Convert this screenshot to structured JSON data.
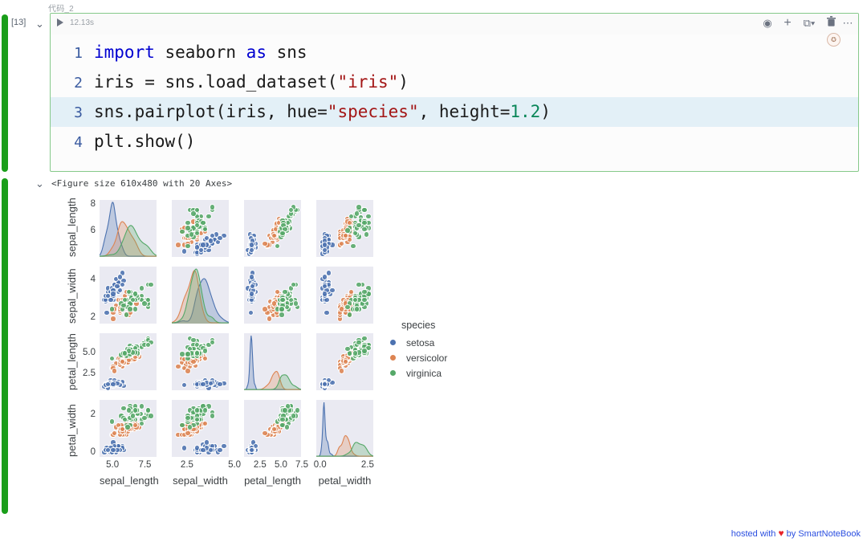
{
  "cell": {
    "title": "代码_2",
    "exec_count": "[13]",
    "exec_time": "12.13s",
    "chevron": "⌄",
    "toolbar": {
      "eye": "◉",
      "plus": "+",
      "copy": "⧉▾",
      "trash": "Ὕ1",
      "more": "⋯",
      "avatar": "✪"
    },
    "code_lines": [
      {
        "no": "1",
        "highlighted": false,
        "tokens": [
          {
            "t": "import ",
            "c": "kw"
          },
          {
            "t": "seaborn ",
            "c": "plain"
          },
          {
            "t": "as ",
            "c": "kw"
          },
          {
            "t": "sns",
            "c": "plain"
          }
        ]
      },
      {
        "no": "2",
        "highlighted": false,
        "tokens": [
          {
            "t": "iris = sns.load_dataset(",
            "c": "plain"
          },
          {
            "t": "\"iris\"",
            "c": "str"
          },
          {
            "t": ")",
            "c": "plain"
          }
        ]
      },
      {
        "no": "3",
        "highlighted": true,
        "tokens": [
          {
            "t": "sns.pairplot(iris, hue=",
            "c": "plain"
          },
          {
            "t": "\"species\"",
            "c": "str"
          },
          {
            "t": ", height=",
            "c": "plain"
          },
          {
            "t": "1.2",
            "c": "num"
          },
          {
            "t": ")",
            "c": "plain"
          }
        ]
      },
      {
        "no": "4",
        "highlighted": false,
        "tokens": [
          {
            "t": "plt.show()",
            "c": "plain"
          }
        ]
      }
    ]
  },
  "output": {
    "chevron": "⌄",
    "repr_text": "<Figure size 610x480 with 20 Axes>"
  },
  "footer": {
    "prefix": "hosted with",
    "heart": "♥",
    "suffix": "by SmartNoteBook"
  },
  "chart_data": {
    "type": "scatter",
    "title": "",
    "variables": [
      "sepal_length",
      "sepal_width",
      "petal_length",
      "petal_width"
    ],
    "hue": "species",
    "legend": {
      "title": "species",
      "position": "right",
      "entries": [
        {
          "label": "setosa",
          "color": "#4c72b0"
        },
        {
          "label": "versicolor",
          "color": "#dd8452"
        },
        {
          "label": "virginica",
          "color": "#55a868"
        }
      ]
    },
    "panel_bg": "#eaeaf2",
    "axis_ranges": {
      "sepal_length": [
        4.0,
        8.4
      ],
      "sepal_width": [
        1.7,
        4.7
      ],
      "petal_length": [
        0.6,
        7.4
      ],
      "petal_width": [
        -0.2,
        2.8
      ]
    },
    "xticks": {
      "sepal_length": [
        5.0,
        7.5
      ],
      "sepal_width": [
        2.5,
        5.0
      ],
      "petal_length": [
        2.5,
        5.0,
        7.5
      ],
      "petal_width": [
        0.0,
        2.5
      ]
    },
    "yticks": {
      "sepal_length": [
        8,
        6
      ],
      "sepal_width": [
        4,
        2
      ],
      "petal_length": [
        5.0,
        2.5
      ],
      "petal_width": [
        2,
        0
      ]
    },
    "xtick_labels": {
      "sepal_length": [
        "5.0",
        "7.5"
      ],
      "sepal_width": [
        "2.5",
        "5.0"
      ],
      "petal_length": [
        "2.5",
        "5.0",
        "7.5"
      ],
      "petal_width": [
        "0.0",
        "2.5"
      ]
    },
    "ytick_labels": {
      "sepal_length": [
        "8",
        "6"
      ],
      "sepal_width": [
        "4",
        "2"
      ],
      "petal_length": [
        "5.0",
        "2.5"
      ],
      "petal_width": [
        "2",
        "0"
      ]
    },
    "diagonal": "kde",
    "n_points": 150,
    "species_order": [
      "setosa",
      "versicolor",
      "virginica"
    ],
    "data": {
      "sepal_length": [
        5.1,
        4.9,
        4.7,
        4.6,
        5.0,
        5.4,
        4.6,
        5.0,
        4.4,
        4.9,
        5.4,
        4.8,
        4.8,
        4.3,
        5.8,
        5.7,
        5.4,
        5.1,
        5.7,
        5.1,
        5.4,
        5.1,
        4.6,
        5.1,
        4.8,
        5.0,
        5.0,
        5.2,
        5.2,
        4.7,
        4.8,
        5.4,
        5.2,
        5.5,
        4.9,
        5.0,
        5.5,
        4.9,
        4.4,
        5.1,
        5.0,
        4.5,
        4.4,
        5.0,
        5.1,
        4.8,
        5.1,
        4.6,
        5.3,
        5.0,
        7.0,
        6.4,
        6.9,
        5.5,
        6.5,
        5.7,
        6.3,
        4.9,
        6.6,
        5.2,
        5.0,
        5.9,
        6.0,
        6.1,
        5.6,
        6.7,
        5.6,
        5.8,
        6.2,
        5.6,
        5.9,
        6.1,
        6.3,
        6.1,
        6.4,
        6.6,
        6.8,
        6.7,
        6.0,
        5.7,
        5.5,
        5.5,
        5.8,
        6.0,
        5.4,
        6.0,
        6.7,
        6.3,
        5.6,
        5.5,
        5.5,
        6.1,
        5.8,
        5.0,
        5.6,
        5.7,
        5.7,
        6.2,
        5.1,
        5.7,
        6.3,
        5.8,
        7.1,
        6.3,
        6.5,
        7.6,
        4.9,
        7.3,
        6.7,
        7.2,
        6.5,
        6.4,
        6.8,
        5.7,
        5.8,
        6.4,
        6.5,
        7.7,
        7.7,
        6.0,
        6.9,
        5.6,
        7.7,
        6.3,
        6.7,
        7.2,
        6.2,
        6.1,
        6.4,
        7.2,
        7.4,
        7.9,
        6.4,
        6.3,
        6.1,
        7.7,
        6.3,
        6.4,
        6.0,
        6.9,
        6.7,
        6.9,
        5.8,
        6.8,
        6.7,
        6.7,
        6.3,
        6.5,
        6.2,
        5.9
      ],
      "sepal_width": [
        3.5,
        3.0,
        3.2,
        3.1,
        3.6,
        3.9,
        3.4,
        3.4,
        2.9,
        3.1,
        3.7,
        3.4,
        3.0,
        3.0,
        4.0,
        4.4,
        3.9,
        3.5,
        3.8,
        3.8,
        3.4,
        3.7,
        3.6,
        3.3,
        3.4,
        3.0,
        3.4,
        3.5,
        3.4,
        3.2,
        3.1,
        3.4,
        4.1,
        4.2,
        3.1,
        3.2,
        3.5,
        3.6,
        3.0,
        3.4,
        3.5,
        2.3,
        3.2,
        3.5,
        3.8,
        3.0,
        3.8,
        3.2,
        3.7,
        3.3,
        3.2,
        3.2,
        3.1,
        2.3,
        2.8,
        2.8,
        3.3,
        2.4,
        2.9,
        2.7,
        2.0,
        3.0,
        2.2,
        2.9,
        2.9,
        3.1,
        3.0,
        2.7,
        2.2,
        2.5,
        3.2,
        2.8,
        2.5,
        2.8,
        2.9,
        3.0,
        2.8,
        3.0,
        2.9,
        2.6,
        2.4,
        2.4,
        2.7,
        2.7,
        3.0,
        3.4,
        3.1,
        2.3,
        3.0,
        2.5,
        2.6,
        3.0,
        2.6,
        2.3,
        2.7,
        3.0,
        2.9,
        2.9,
        2.5,
        2.8,
        3.3,
        2.7,
        3.0,
        2.9,
        3.0,
        3.0,
        2.5,
        2.9,
        2.5,
        3.6,
        3.2,
        2.7,
        3.0,
        2.5,
        2.8,
        3.2,
        3.0,
        3.8,
        2.6,
        2.2,
        3.2,
        2.8,
        2.8,
        2.7,
        3.3,
        3.2,
        2.8,
        3.0,
        2.8,
        3.0,
        2.8,
        3.8,
        2.8,
        2.8,
        2.6,
        3.0,
        3.4,
        3.1,
        3.0,
        3.1,
        3.1,
        3.1,
        2.7,
        3.2,
        3.3,
        3.0,
        2.5,
        3.0,
        3.4,
        3.0
      ],
      "petal_length": [
        1.4,
        1.4,
        1.3,
        1.5,
        1.4,
        1.7,
        1.4,
        1.5,
        1.4,
        1.5,
        1.5,
        1.6,
        1.4,
        1.1,
        1.2,
        1.5,
        1.3,
        1.4,
        1.7,
        1.5,
        1.7,
        1.5,
        1.0,
        1.7,
        1.9,
        1.6,
        1.6,
        1.5,
        1.4,
        1.6,
        1.6,
        1.5,
        1.5,
        1.4,
        1.5,
        1.2,
        1.3,
        1.4,
        1.3,
        1.5,
        1.3,
        1.3,
        1.3,
        1.6,
        1.9,
        1.4,
        1.6,
        1.4,
        1.5,
        1.4,
        4.7,
        4.5,
        4.9,
        4.0,
        4.6,
        4.5,
        4.7,
        3.3,
        4.6,
        3.9,
        3.5,
        4.2,
        4.0,
        4.7,
        3.6,
        4.4,
        4.5,
        4.1,
        4.5,
        3.9,
        4.8,
        4.0,
        4.9,
        4.7,
        4.3,
        4.4,
        4.8,
        5.0,
        4.5,
        3.5,
        3.8,
        3.7,
        3.9,
        5.1,
        4.5,
        4.5,
        4.7,
        4.4,
        4.1,
        4.0,
        4.4,
        4.6,
        4.0,
        3.3,
        4.2,
        4.2,
        4.2,
        4.3,
        3.0,
        4.1,
        6.0,
        5.1,
        5.9,
        5.6,
        5.8,
        6.6,
        4.5,
        6.3,
        5.8,
        6.1,
        5.1,
        5.3,
        5.5,
        5.0,
        5.1,
        5.3,
        5.5,
        6.7,
        6.9,
        5.0,
        5.7,
        4.9,
        6.7,
        4.9,
        5.7,
        6.0,
        4.8,
        4.9,
        5.6,
        5.8,
        6.1,
        6.4,
        5.6,
        5.1,
        5.6,
        6.1,
        5.6,
        5.5,
        4.8,
        5.4,
        5.6,
        5.1,
        5.1,
        5.9,
        5.7,
        5.2,
        5.0,
        5.2,
        5.4,
        5.1
      ],
      "petal_width": [
        0.2,
        0.2,
        0.2,
        0.2,
        0.2,
        0.4,
        0.3,
        0.2,
        0.2,
        0.1,
        0.2,
        0.2,
        0.1,
        0.1,
        0.2,
        0.4,
        0.4,
        0.3,
        0.3,
        0.3,
        0.2,
        0.4,
        0.2,
        0.5,
        0.2,
        0.2,
        0.4,
        0.2,
        0.2,
        0.2,
        0.2,
        0.4,
        0.1,
        0.2,
        0.2,
        0.2,
        0.2,
        0.1,
        0.2,
        0.2,
        0.3,
        0.3,
        0.2,
        0.6,
        0.4,
        0.3,
        0.2,
        0.2,
        0.2,
        0.2,
        1.4,
        1.5,
        1.5,
        1.3,
        1.5,
        1.3,
        1.6,
        1.0,
        1.3,
        1.4,
        1.0,
        1.5,
        1.0,
        1.4,
        1.3,
        1.4,
        1.5,
        1.0,
        1.5,
        1.1,
        1.8,
        1.3,
        1.5,
        1.2,
        1.3,
        1.4,
        1.4,
        1.7,
        1.5,
        1.0,
        1.1,
        1.0,
        1.2,
        1.6,
        1.5,
        1.6,
        1.5,
        1.3,
        1.3,
        1.3,
        1.2,
        1.4,
        1.2,
        1.0,
        1.3,
        1.2,
        1.3,
        1.3,
        1.1,
        1.3,
        2.5,
        1.9,
        2.1,
        1.8,
        2.2,
        2.1,
        1.7,
        1.8,
        1.8,
        2.5,
        2.0,
        1.9,
        2.1,
        2.0,
        2.4,
        2.3,
        1.8,
        2.2,
        2.3,
        1.5,
        2.3,
        2.0,
        2.0,
        1.8,
        2.1,
        1.8,
        1.8,
        1.8,
        2.1,
        1.6,
        1.9,
        2.0,
        2.2,
        1.5,
        1.4,
        2.3,
        2.4,
        1.8,
        1.8,
        2.1,
        2.4,
        2.3,
        1.9,
        2.3,
        2.5,
        2.3,
        1.9,
        2.0,
        2.3,
        1.8
      ],
      "species": [
        "setosa",
        "setosa",
        "setosa",
        "setosa",
        "setosa",
        "setosa",
        "setosa",
        "setosa",
        "setosa",
        "setosa",
        "setosa",
        "setosa",
        "setosa",
        "setosa",
        "setosa",
        "setosa",
        "setosa",
        "setosa",
        "setosa",
        "setosa",
        "setosa",
        "setosa",
        "setosa",
        "setosa",
        "setosa",
        "setosa",
        "setosa",
        "setosa",
        "setosa",
        "setosa",
        "setosa",
        "setosa",
        "setosa",
        "setosa",
        "setosa",
        "setosa",
        "setosa",
        "setosa",
        "setosa",
        "setosa",
        "setosa",
        "setosa",
        "setosa",
        "setosa",
        "setosa",
        "setosa",
        "setosa",
        "setosa",
        "setosa",
        "setosa",
        "versicolor",
        "versicolor",
        "versicolor",
        "versicolor",
        "versicolor",
        "versicolor",
        "versicolor",
        "versicolor",
        "versicolor",
        "versicolor",
        "versicolor",
        "versicolor",
        "versicolor",
        "versicolor",
        "versicolor",
        "versicolor",
        "versicolor",
        "versicolor",
        "versicolor",
        "versicolor",
        "versicolor",
        "versicolor",
        "versicolor",
        "versicolor",
        "versicolor",
        "versicolor",
        "versicolor",
        "versicolor",
        "versicolor",
        "versicolor",
        "versicolor",
        "versicolor",
        "versicolor",
        "versicolor",
        "versicolor",
        "versicolor",
        "versicolor",
        "versicolor",
        "versicolor",
        "versicolor",
        "versicolor",
        "versicolor",
        "versicolor",
        "versicolor",
        "versicolor",
        "versicolor",
        "versicolor",
        "versicolor",
        "versicolor",
        "versicolor",
        "virginica",
        "virginica",
        "virginica",
        "virginica",
        "virginica",
        "virginica",
        "virginica",
        "virginica",
        "virginica",
        "virginica",
        "virginica",
        "virginica",
        "virginica",
        "virginica",
        "virginica",
        "virginica",
        "virginica",
        "virginica",
        "virginica",
        "virginica",
        "virginica",
        "virginica",
        "virginica",
        "virginica",
        "virginica",
        "virginica",
        "virginica",
        "virginica",
        "virginica",
        "virginica",
        "virginica",
        "virginica",
        "virginica",
        "virginica",
        "virginica",
        "virginica",
        "virginica",
        "virginica",
        "virginica",
        "virginica",
        "virginica",
        "virginica",
        "virginica",
        "virginica",
        "virginica",
        "virginica",
        "virginica",
        "virginica",
        "virginica",
        "virginica"
      ]
    }
  }
}
